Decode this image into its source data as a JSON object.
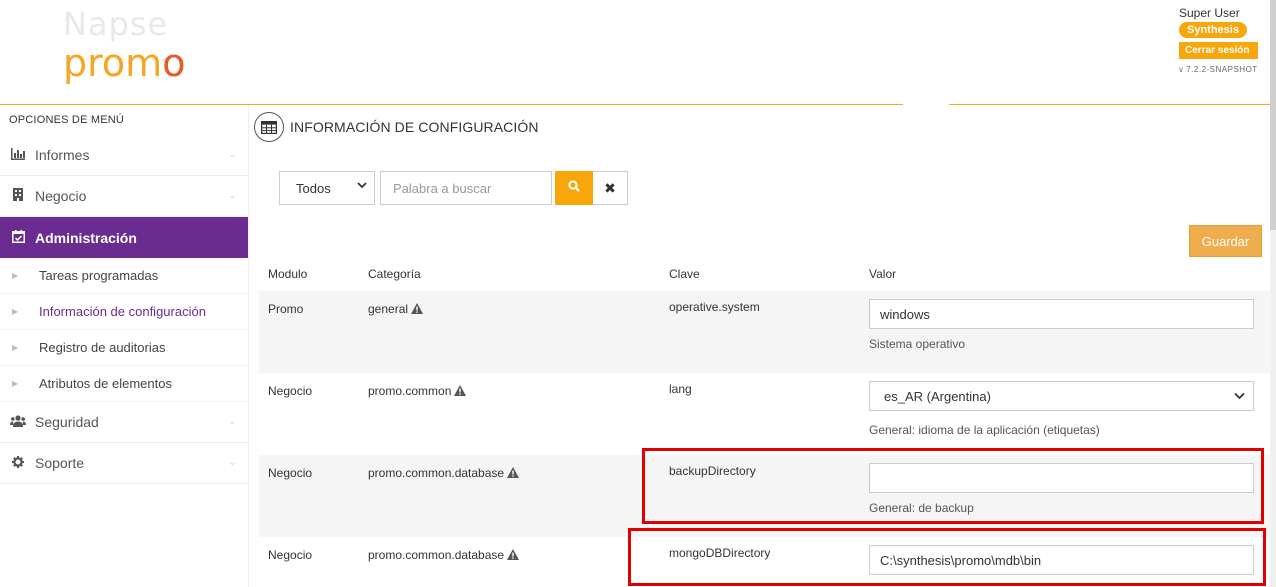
{
  "logo": {
    "top": "Napse",
    "bottom_p": "pr",
    "bottom_o1": "o",
    "bottom_m": "m",
    "bottom_o2": "o"
  },
  "user": {
    "name": "Super User",
    "company": "Synthesis",
    "logout_label": "Cerrar sesión",
    "version": "v 7.2.2-SNAPSHOT"
  },
  "sidebar": {
    "title": "OPCIONES DE MENÚ",
    "items": [
      {
        "label": "Informes",
        "icon": "bar-chart-icon"
      },
      {
        "label": "Negocio",
        "icon": "building-icon"
      },
      {
        "label": "Administración",
        "icon": "calendar-check-icon"
      },
      {
        "label": "Seguridad",
        "icon": "users-icon"
      },
      {
        "label": "Soporte",
        "icon": "gear-icon"
      }
    ],
    "subitems": [
      {
        "label": "Tareas programadas"
      },
      {
        "label": "Información de configuración"
      },
      {
        "label": "Registro de auditorias"
      },
      {
        "label": "Atributos de elementos"
      }
    ]
  },
  "page": {
    "title": "INFORMACIÓN DE CONFIGURACIÓN"
  },
  "filter": {
    "selected": "Todos",
    "placeholder": "Palabra a buscar"
  },
  "save_label": "Guardar",
  "table": {
    "headers": {
      "module": "Modulo",
      "category": "Categoría",
      "key": "Clave",
      "value": "Valor"
    },
    "rows": [
      {
        "module": "Promo",
        "category": "general",
        "key": "operative.system",
        "value": "windows",
        "description": "Sistema operativo"
      },
      {
        "module": "Negocio",
        "category": "promo.common",
        "key": "lang",
        "value": "es_AR (Argentina)",
        "description": "General: idioma de la aplicación (etiquetas)"
      },
      {
        "module": "Negocio",
        "category": "promo.common.database",
        "key": "backupDirectory",
        "value": "",
        "description": "General: de backup"
      },
      {
        "module": "Negocio",
        "category": "promo.common.database",
        "key": "mongoDBDirectory",
        "value": "C:\\synthesis\\promo\\mdb\\bin",
        "description": ""
      }
    ]
  },
  "colors": {
    "accent": "#f7a70a",
    "purple": "#6a2c91",
    "highlight": "#e00000"
  }
}
